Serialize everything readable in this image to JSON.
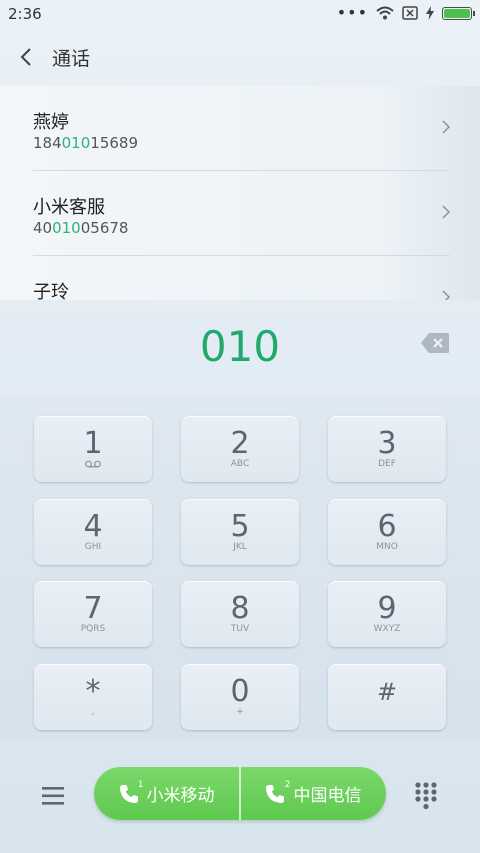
{
  "status_bar": {
    "time": "2:36",
    "more": "•••",
    "battery_level": 1.0
  },
  "header": {
    "title": "通话"
  },
  "results": [
    {
      "name": "燕婷",
      "num_pre": "184",
      "num_match": "010",
      "num_post": "15689"
    },
    {
      "name": "小米客服",
      "num_pre": "40",
      "num_match": "010",
      "num_post": "05678"
    },
    {
      "name": "子玲",
      "num_pre": "",
      "num_match": "",
      "num_post": ""
    }
  ],
  "dial": {
    "number": "010"
  },
  "keys": [
    {
      "digit": "1",
      "sub": ""
    },
    {
      "digit": "2",
      "sub": "ABC"
    },
    {
      "digit": "3",
      "sub": "DEF"
    },
    {
      "digit": "4",
      "sub": "GHI"
    },
    {
      "digit": "5",
      "sub": "JKL"
    },
    {
      "digit": "6",
      "sub": "MNO"
    },
    {
      "digit": "7",
      "sub": "PQRS"
    },
    {
      "digit": "8",
      "sub": "TUV"
    },
    {
      "digit": "9",
      "sub": "WXYZ"
    },
    {
      "digit": "*",
      "sub": ","
    },
    {
      "digit": "0",
      "sub": "+"
    },
    {
      "digit": "#",
      "sub": ""
    }
  ],
  "call": {
    "sim1_label": "小米移动",
    "sim1_index": "1",
    "sim2_label": "中国电信",
    "sim2_index": "2"
  },
  "colors": {
    "accent": "#21a86f",
    "call_green": "#6ad05a"
  }
}
